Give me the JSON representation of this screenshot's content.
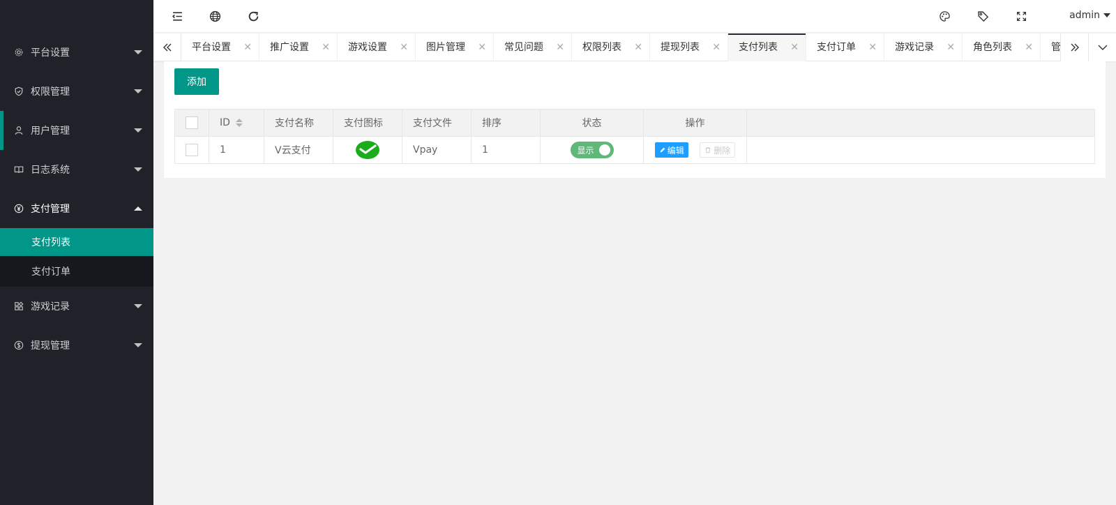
{
  "sidebar": {
    "items": [
      {
        "label": "平台设置",
        "icon": "gear-icon"
      },
      {
        "label": "权限管理",
        "icon": "shield-icon"
      },
      {
        "label": "用户管理",
        "icon": "user-icon"
      },
      {
        "label": "日志系统",
        "icon": "book-icon"
      },
      {
        "label": "支付管理",
        "icon": "yen-icon"
      },
      {
        "label": "游戏记录",
        "icon": "apps-icon"
      },
      {
        "label": "提现管理",
        "icon": "dollar-icon"
      }
    ],
    "submenu": [
      {
        "label": "支付列表"
      },
      {
        "label": "支付订单"
      }
    ]
  },
  "header": {
    "user": "admin"
  },
  "tabs": [
    {
      "label": "平台设置"
    },
    {
      "label": "推广设置"
    },
    {
      "label": "游戏设置"
    },
    {
      "label": "图片管理"
    },
    {
      "label": "常见问题"
    },
    {
      "label": "权限列表"
    },
    {
      "label": "提现列表"
    },
    {
      "label": "支付列表"
    },
    {
      "label": "支付订单"
    },
    {
      "label": "游戏记录"
    },
    {
      "label": "角色列表"
    },
    {
      "label": "管"
    }
  ],
  "toolbar": {
    "add_label": "添加"
  },
  "table": {
    "columns": [
      "ID",
      "支付名称",
      "支付图标",
      "支付文件",
      "排序",
      "状态",
      "操作"
    ],
    "rows": [
      {
        "id": "1",
        "name": "V云支付",
        "file": "Vpay",
        "sort": "1",
        "status": "显示",
        "edit": "编辑",
        "delete": "删除"
      }
    ]
  },
  "colors": {
    "accent": "#009688",
    "sidebar_bg": "#20222a",
    "edit_blue": "#1e9fff",
    "switch_green": "#5fb878"
  }
}
